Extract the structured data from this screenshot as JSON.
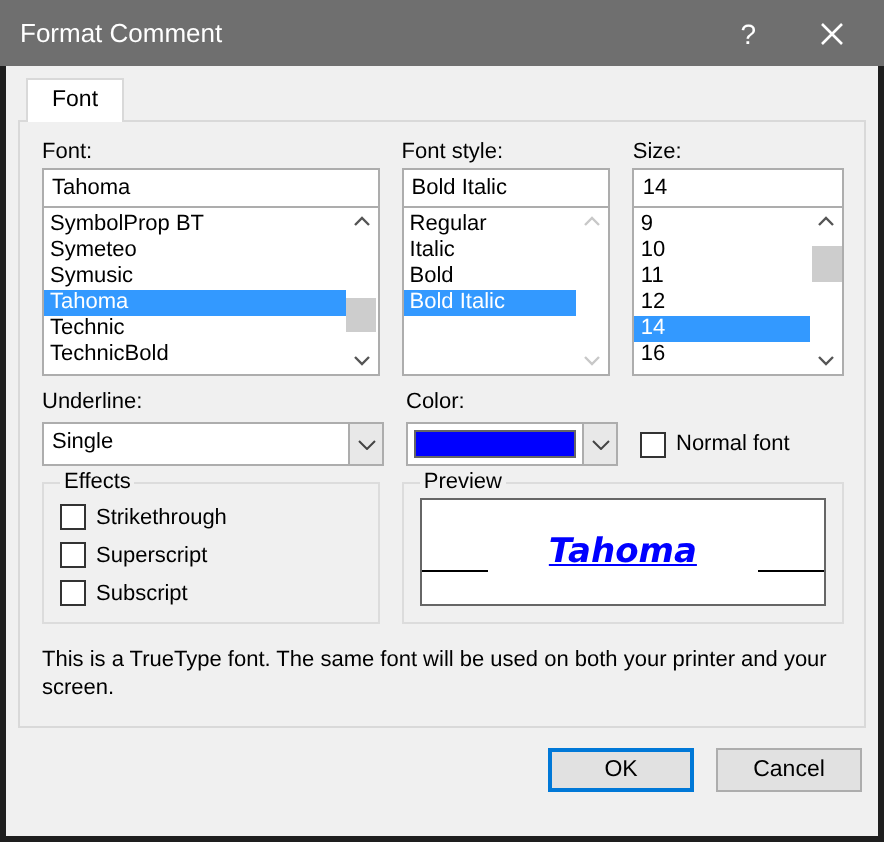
{
  "window": {
    "title": "Format Comment",
    "help": "?"
  },
  "tabs": [
    {
      "label": "Font",
      "selected": true
    }
  ],
  "font": {
    "label": "Font:",
    "value": "Tahoma",
    "items": [
      {
        "label": "SymbolProp BT",
        "selected": false
      },
      {
        "label": "Symeteo",
        "selected": false
      },
      {
        "label": "Symusic",
        "selected": false
      },
      {
        "label": "Tahoma",
        "selected": true
      },
      {
        "label": "Technic",
        "selected": false
      },
      {
        "label": "TechnicBold",
        "selected": false
      }
    ]
  },
  "font_style": {
    "label": "Font style:",
    "value": "Bold Italic",
    "items": [
      {
        "label": "Regular",
        "selected": false
      },
      {
        "label": "Italic",
        "selected": false
      },
      {
        "label": "Bold",
        "selected": false
      },
      {
        "label": "Bold Italic",
        "selected": true
      }
    ]
  },
  "size": {
    "label": "Size:",
    "value": "14",
    "items": [
      {
        "label": "9",
        "selected": false
      },
      {
        "label": "10",
        "selected": false
      },
      {
        "label": "11",
        "selected": false
      },
      {
        "label": "12",
        "selected": false
      },
      {
        "label": "14",
        "selected": true
      },
      {
        "label": "16",
        "selected": false
      }
    ]
  },
  "underline": {
    "label": "Underline:",
    "value": "Single"
  },
  "color": {
    "label": "Color:",
    "color": "#0000ff"
  },
  "normal_font": {
    "label": "Normal font",
    "checked": false
  },
  "effects": {
    "title": "Effects",
    "options": [
      {
        "label": "Strikethrough",
        "checked": false
      },
      {
        "label": "Superscript",
        "checked": false
      },
      {
        "label": "Subscript",
        "checked": false
      }
    ]
  },
  "preview": {
    "title": "Preview",
    "sample": "Tahoma"
  },
  "note": "This is a TrueType font.  The same font will be used on both your printer and your screen.",
  "buttons": [
    {
      "label": "OK",
      "default": true
    },
    {
      "label": "Cancel",
      "default": false
    }
  ]
}
